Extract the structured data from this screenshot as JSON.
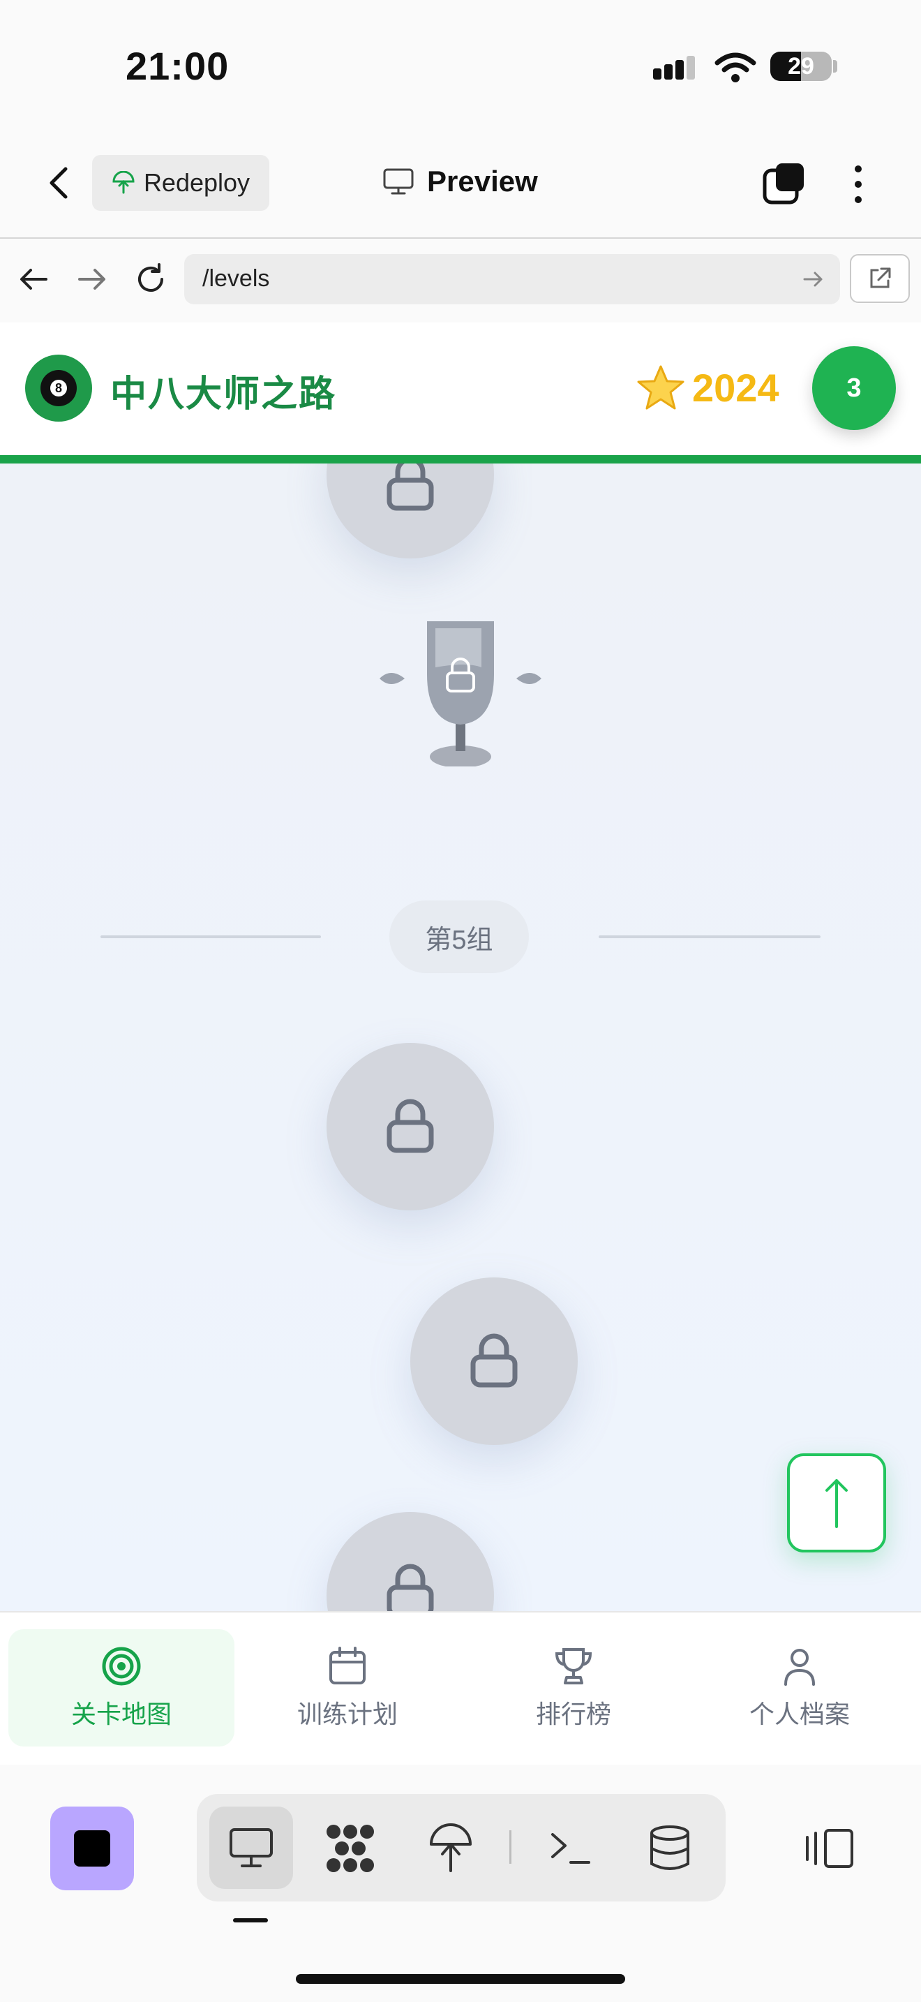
{
  "status_bar": {
    "time": "21:00",
    "battery": "29"
  },
  "toolbar": {
    "redeploy_label": "Redeploy",
    "preview_label": "Preview"
  },
  "browser": {
    "url": "/levels"
  },
  "header": {
    "title": "中八大师之路",
    "stars": "2024",
    "level": "3"
  },
  "map": {
    "group_label": "第5组",
    "nodes": [
      {
        "name": "locked-level-node",
        "state": "locked"
      },
      {
        "name": "locked-trophy",
        "state": "locked"
      },
      {
        "name": "locked-level-node",
        "state": "locked"
      },
      {
        "name": "locked-level-node",
        "state": "locked"
      },
      {
        "name": "locked-level-node",
        "state": "locked"
      }
    ]
  },
  "bottom_nav": {
    "items": [
      {
        "label": "关卡地图",
        "icon": "target-icon",
        "active": true
      },
      {
        "label": "训练计划",
        "icon": "calendar-icon",
        "active": false
      },
      {
        "label": "排行榜",
        "icon": "trophy-icon",
        "active": false
      },
      {
        "label": "个人档案",
        "icon": "user-icon",
        "active": false
      }
    ]
  },
  "colors": {
    "brand_green": "#1a8a45",
    "accent_green": "#22c55e",
    "star_gold": "#f5b914",
    "locked_gray": "#d3d6dd",
    "stop_purple": "#b9a6ff"
  }
}
